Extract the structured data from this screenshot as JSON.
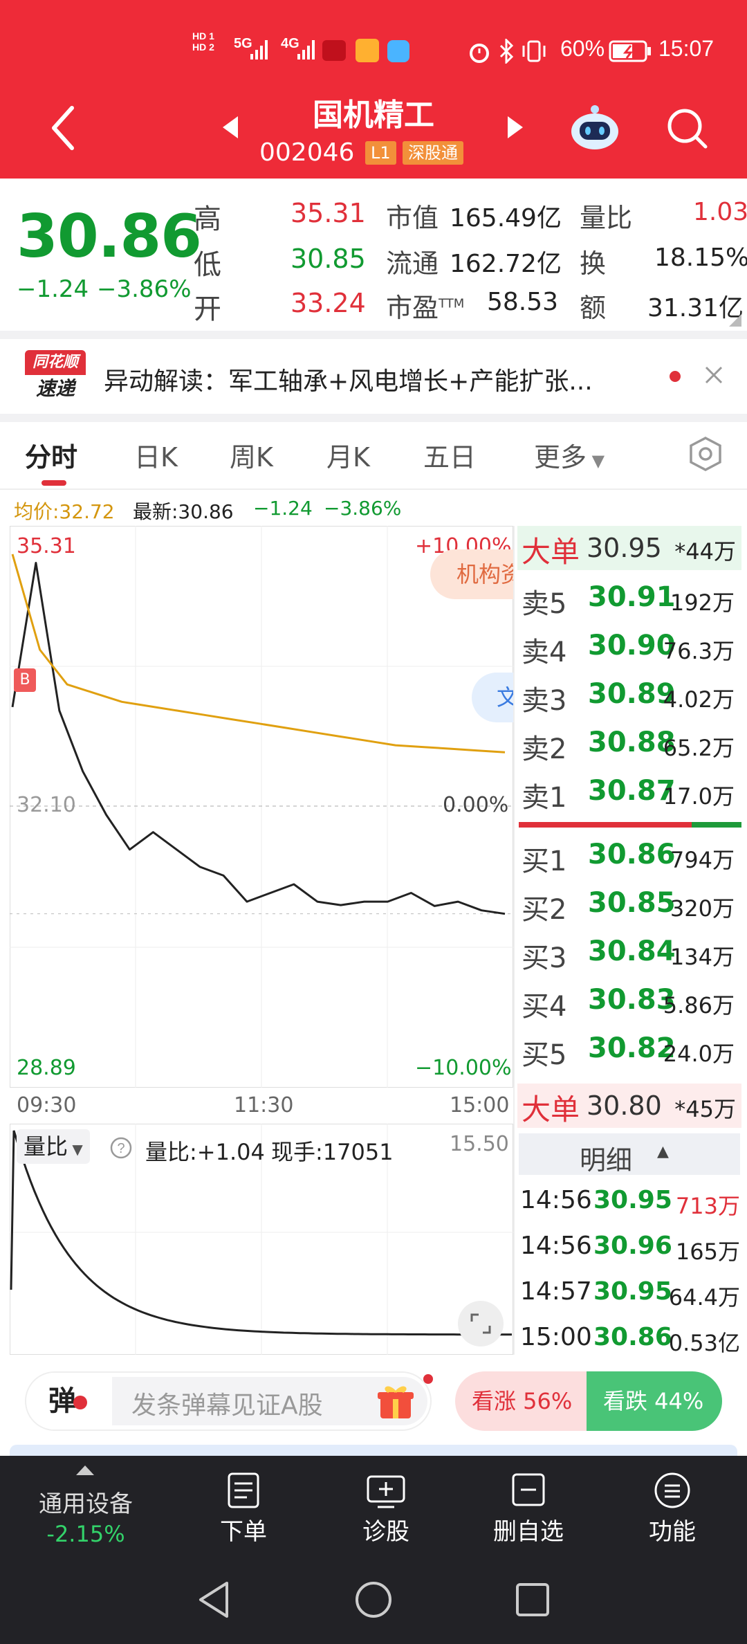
{
  "status_bar": {
    "hd1": "HD 1",
    "hd2": "HD 2",
    "net1": "5G",
    "net2": "4G",
    "battery": "60%",
    "time": "15:07"
  },
  "header": {
    "title": "国机精工",
    "code": "002046",
    "badge_l1": "L1",
    "badge_conn": "深股通"
  },
  "quote": {
    "price": "30.86",
    "change": "−1.24",
    "change_pct": "−3.86%",
    "high_label": "高",
    "high": "35.31",
    "low_label": "低",
    "low": "30.85",
    "open_label": "开",
    "open": "33.24",
    "mcap_label": "市值",
    "mcap": "165.49亿",
    "float_label": "流通",
    "float": "162.72亿",
    "pe_label": "市盈",
    "pe_sup": "TTM",
    "pe": "58.53",
    "vr_label": "量比",
    "vr": "1.03",
    "turn_label": "换",
    "turn": "18.15%",
    "amt_label": "额",
    "amt": "31.31亿"
  },
  "news": {
    "logo_top": "同花顺",
    "logo_bottom": "速递",
    "text": "异动解读：军工轴承+风电增长+产能扩张..."
  },
  "tabs": {
    "t1": "分时",
    "t2": "日K",
    "t3": "周K",
    "t4": "月K",
    "t5": "五日",
    "t6": "更多"
  },
  "info_line": {
    "avg": "均价:32.72",
    "latest": "最新:30.86",
    "chg": "−1.24",
    "pct": "−3.86%"
  },
  "chart": {
    "y_high": "35.31",
    "y_mid": "32.10",
    "y_low": "28.89",
    "pct_high": "+10.00%",
    "pct_mid": "0.00%",
    "pct_low": "−10.00%",
    "x1": "09:30",
    "x2": "11:30",
    "x3": "15:00",
    "tag_b": "B",
    "inst_label": "机构资",
    "doc_label": "文",
    "chart_data": {
      "type": "line",
      "x_range": [
        "09:30",
        "15:00"
      ],
      "ylim": [
        28.89,
        35.31
      ],
      "series": [
        {
          "name": "最新",
          "values": [
            33.24,
            34.9,
            33.2,
            32.5,
            32.0,
            31.6,
            31.8,
            31.6,
            31.4,
            31.3,
            31.0,
            31.1,
            31.2,
            31.0,
            30.96,
            31.0,
            31.0,
            31.1,
            30.95,
            31.0,
            30.9,
            30.86
          ]
        },
        {
          "name": "均价",
          "values": [
            35.0,
            33.9,
            33.5,
            33.4,
            33.3,
            33.25,
            33.2,
            33.15,
            33.1,
            33.05,
            33.0,
            32.95,
            32.9,
            32.85,
            32.8,
            32.78,
            32.76,
            32.74,
            32.72
          ]
        }
      ],
      "yref": 32.1,
      "color_price": "#222222",
      "color_avg": "#e0a010"
    }
  },
  "orderbook": {
    "big_sell_label": "大单",
    "big_sell_price": "30.95",
    "big_sell_vol": "*44万",
    "asks": [
      {
        "k": "卖5",
        "p": "30.91",
        "v": "192万"
      },
      {
        "k": "卖4",
        "p": "30.90",
        "v": "76.3万"
      },
      {
        "k": "卖3",
        "p": "30.89",
        "v": "4.02万"
      },
      {
        "k": "卖2",
        "p": "30.88",
        "v": "65.2万"
      },
      {
        "k": "卖1",
        "p": "30.87",
        "v": "17.0万"
      }
    ],
    "bids": [
      {
        "k": "买1",
        "p": "30.86",
        "v": "794万"
      },
      {
        "k": "买2",
        "p": "30.85",
        "v": "320万"
      },
      {
        "k": "买3",
        "p": "30.84",
        "v": "134万"
      },
      {
        "k": "买4",
        "p": "30.83",
        "v": "5.86万"
      },
      {
        "k": "买5",
        "p": "30.82",
        "v": "24.0万"
      }
    ],
    "big_buy_label": "大单",
    "big_buy_price": "30.80",
    "big_buy_vol": "*45万"
  },
  "detail": {
    "title": "明细",
    "rows": [
      {
        "t": "14:56",
        "p": "30.95",
        "v": "713万"
      },
      {
        "t": "14:56",
        "p": "30.96",
        "v": "165万"
      },
      {
        "t": "14:57",
        "p": "30.95",
        "v": "64.4万"
      },
      {
        "t": "15:00",
        "p": "30.86",
        "v": "0.53亿"
      }
    ]
  },
  "volume": {
    "label": "量比",
    "value": "量比:+1.04",
    "hand": "现手:17051",
    "max": "15.50"
  },
  "danmu": {
    "icon": "弹",
    "placeholder": "发条弹幕见证A股",
    "up": "看涨 56%",
    "down": "看跌 44%"
  },
  "bottom_nav": {
    "sector": "通用设备",
    "sector_chg": "-2.15%",
    "order": "下单",
    "diagnose": "诊股",
    "delete": "删自选",
    "func": "功能"
  }
}
